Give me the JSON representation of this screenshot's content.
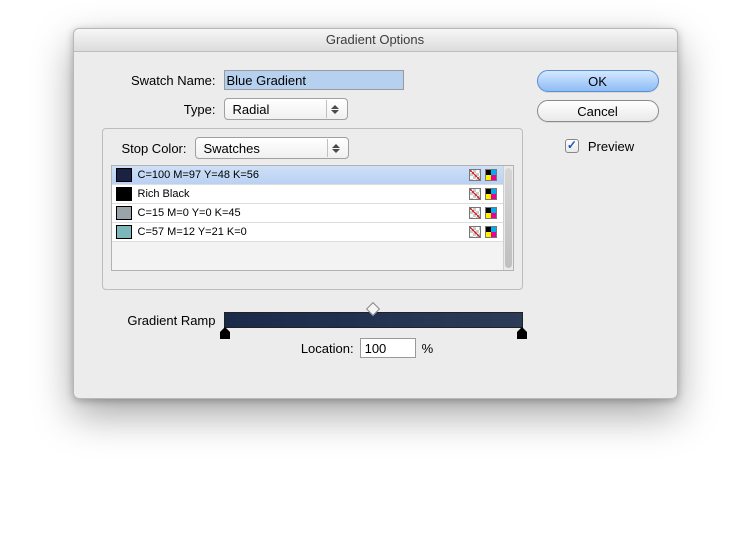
{
  "title": "Gradient Options",
  "labels": {
    "swatch_name": "Swatch Name:",
    "type": "Type:",
    "stop_color": "Stop Color:",
    "gradient_ramp": "Gradient Ramp",
    "location": "Location:",
    "percent": "%"
  },
  "fields": {
    "swatch_name_value": "Blue Gradient",
    "type_value": "Radial",
    "stop_color_value": "Swatches",
    "location_value": "100"
  },
  "swatches": [
    {
      "name": "C=100 M=97 Y=48 K=56",
      "color": "#1a2243",
      "selected": true
    },
    {
      "name": "Rich Black",
      "color": "#000000",
      "selected": false
    },
    {
      "name": "C=15 M=0 Y=0 K=45",
      "color": "#9aa3a7",
      "selected": false
    },
    {
      "name": "C=57 M=12 Y=21 K=0",
      "color": "#7cb7bc",
      "selected": false
    }
  ],
  "ramp": {
    "start_color": "#1a2a4a",
    "end_color": "#2c3b58",
    "midpoint_pct": 50,
    "stops": [
      {
        "pct": 0,
        "filled": true
      },
      {
        "pct": 100,
        "filled": true
      }
    ]
  },
  "buttons": {
    "ok": "OK",
    "cancel": "Cancel",
    "preview": "Preview"
  },
  "preview_checked": true
}
